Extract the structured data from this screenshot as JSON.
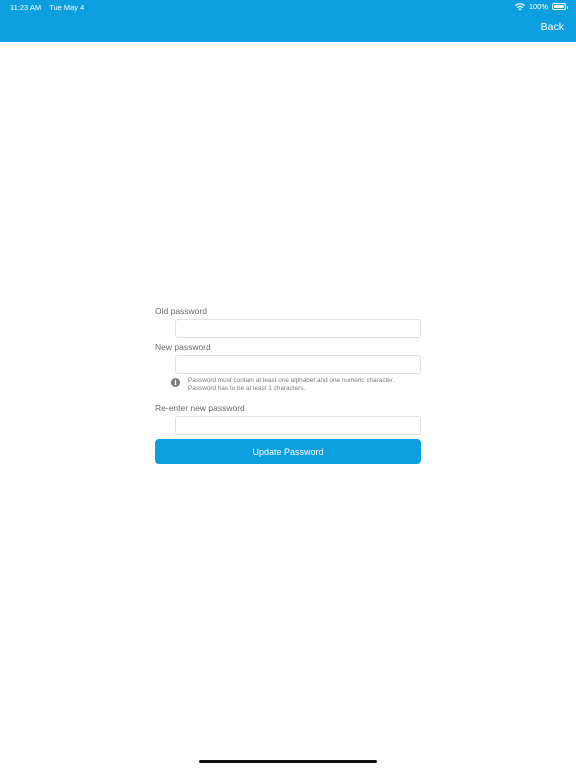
{
  "status_bar": {
    "time": "11:23 AM",
    "date": "Tue May 4",
    "battery_percent": "100%",
    "battery_level": 1.0,
    "icons": [
      "wifi-icon",
      "battery-icon"
    ]
  },
  "nav": {
    "back_label": "Back",
    "bar_color": "#0b9fe0"
  },
  "form": {
    "old_password_label": "Old password",
    "old_password_value": "",
    "new_password_label": "New password",
    "new_password_value": "",
    "hint_line1": "Password must contain at least one alphabet and one numeric character.",
    "hint_line2": "Password has to be at least 1 characters.",
    "reenter_label": "Re-enter new password",
    "reenter_value": "",
    "submit_label": "Update Password",
    "accent_color": "#0b9fe0"
  }
}
